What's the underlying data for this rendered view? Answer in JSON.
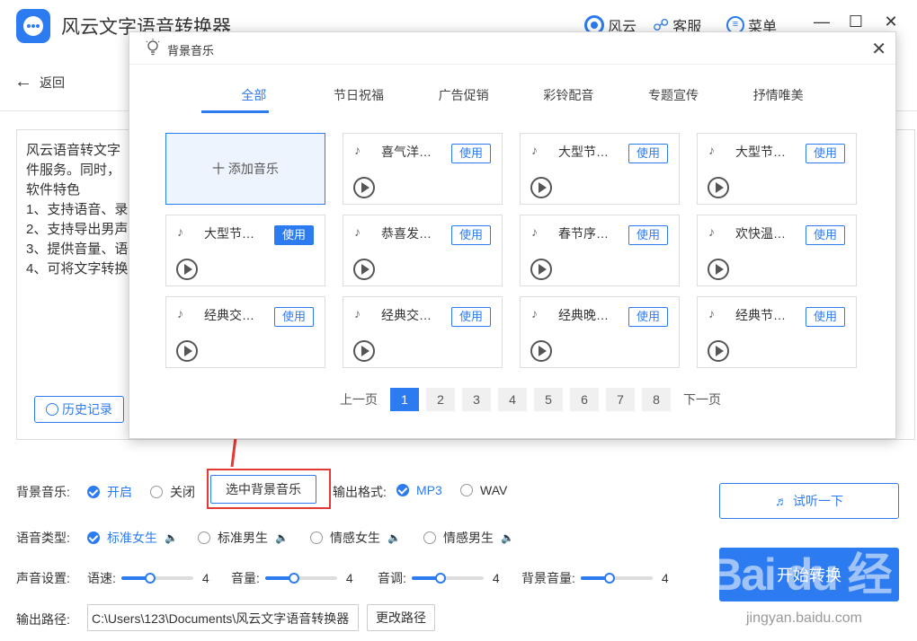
{
  "app": {
    "title": "风云文字语音转换器",
    "brand_color": "#2d7bf0"
  },
  "titlebar": {
    "items": [
      {
        "icon": "fengyun-icon",
        "label": "风云"
      },
      {
        "icon": "headset-icon",
        "label": "客服"
      },
      {
        "icon": "menu-icon",
        "label": "菜单"
      }
    ],
    "window_buttons": [
      "minimize",
      "maximize",
      "close"
    ]
  },
  "subbar": {
    "back_label": "返回"
  },
  "editor": {
    "text": "风云语音转文字\n件服务。同时，\n软件特色\n1、支持语音、录\n2、支持导出男声\n3、提供音量、语\n4、可将文字转换",
    "history_label": "历史记录"
  },
  "settings": {
    "bg_music_label": "背景音乐:",
    "bg_music_on": "开启",
    "bg_music_off": "关闭",
    "select_bg_label": "选中背景音乐",
    "format_label": "输出格式:",
    "format_mp3": "MP3",
    "format_wav": "WAV",
    "voice_label": "语音类型:",
    "voices": [
      "标准女生",
      "标准男生",
      "情感女生",
      "情感男生"
    ],
    "sound_label": "声音设置:",
    "sliders": [
      {
        "label": "语速:",
        "value": "4",
        "level": 0.4
      },
      {
        "label": "音量:",
        "value": "4",
        "level": 0.4
      },
      {
        "label": "音调:",
        "value": "4",
        "level": 0.4
      },
      {
        "label": "背景音量:",
        "value": "4",
        "level": 0.4
      }
    ],
    "path_label": "输出路径:",
    "path_value": "C:\\Users\\123\\Documents\\风云文字语音转换器",
    "change_path_label": "更改路径",
    "listen_label": "试听一下",
    "start_label": "开始转换"
  },
  "watermark": {
    "main": "Bai du 经验",
    "sub": "jingyan.baidu.com"
  },
  "modal": {
    "title": "背景音乐",
    "tabs": [
      "全部",
      "节日祝福",
      "广告促销",
      "彩铃配音",
      "专题宣传",
      "抒情唯美"
    ],
    "active_tab": 0,
    "add_label": "十 添加音乐",
    "use_label": "使用",
    "cards": [
      "喜气洋…",
      "大型节…",
      "大型节…",
      "大型节…",
      "恭喜发…",
      "春节序…",
      "欢快温…",
      "经典交…",
      "经典交…",
      "经典晚…",
      "经典节…"
    ],
    "pagination": {
      "prev": "上一页",
      "next": "下一页",
      "pages": [
        "1",
        "2",
        "3",
        "4",
        "5",
        "6",
        "7",
        "8"
      ],
      "current": "1"
    }
  }
}
